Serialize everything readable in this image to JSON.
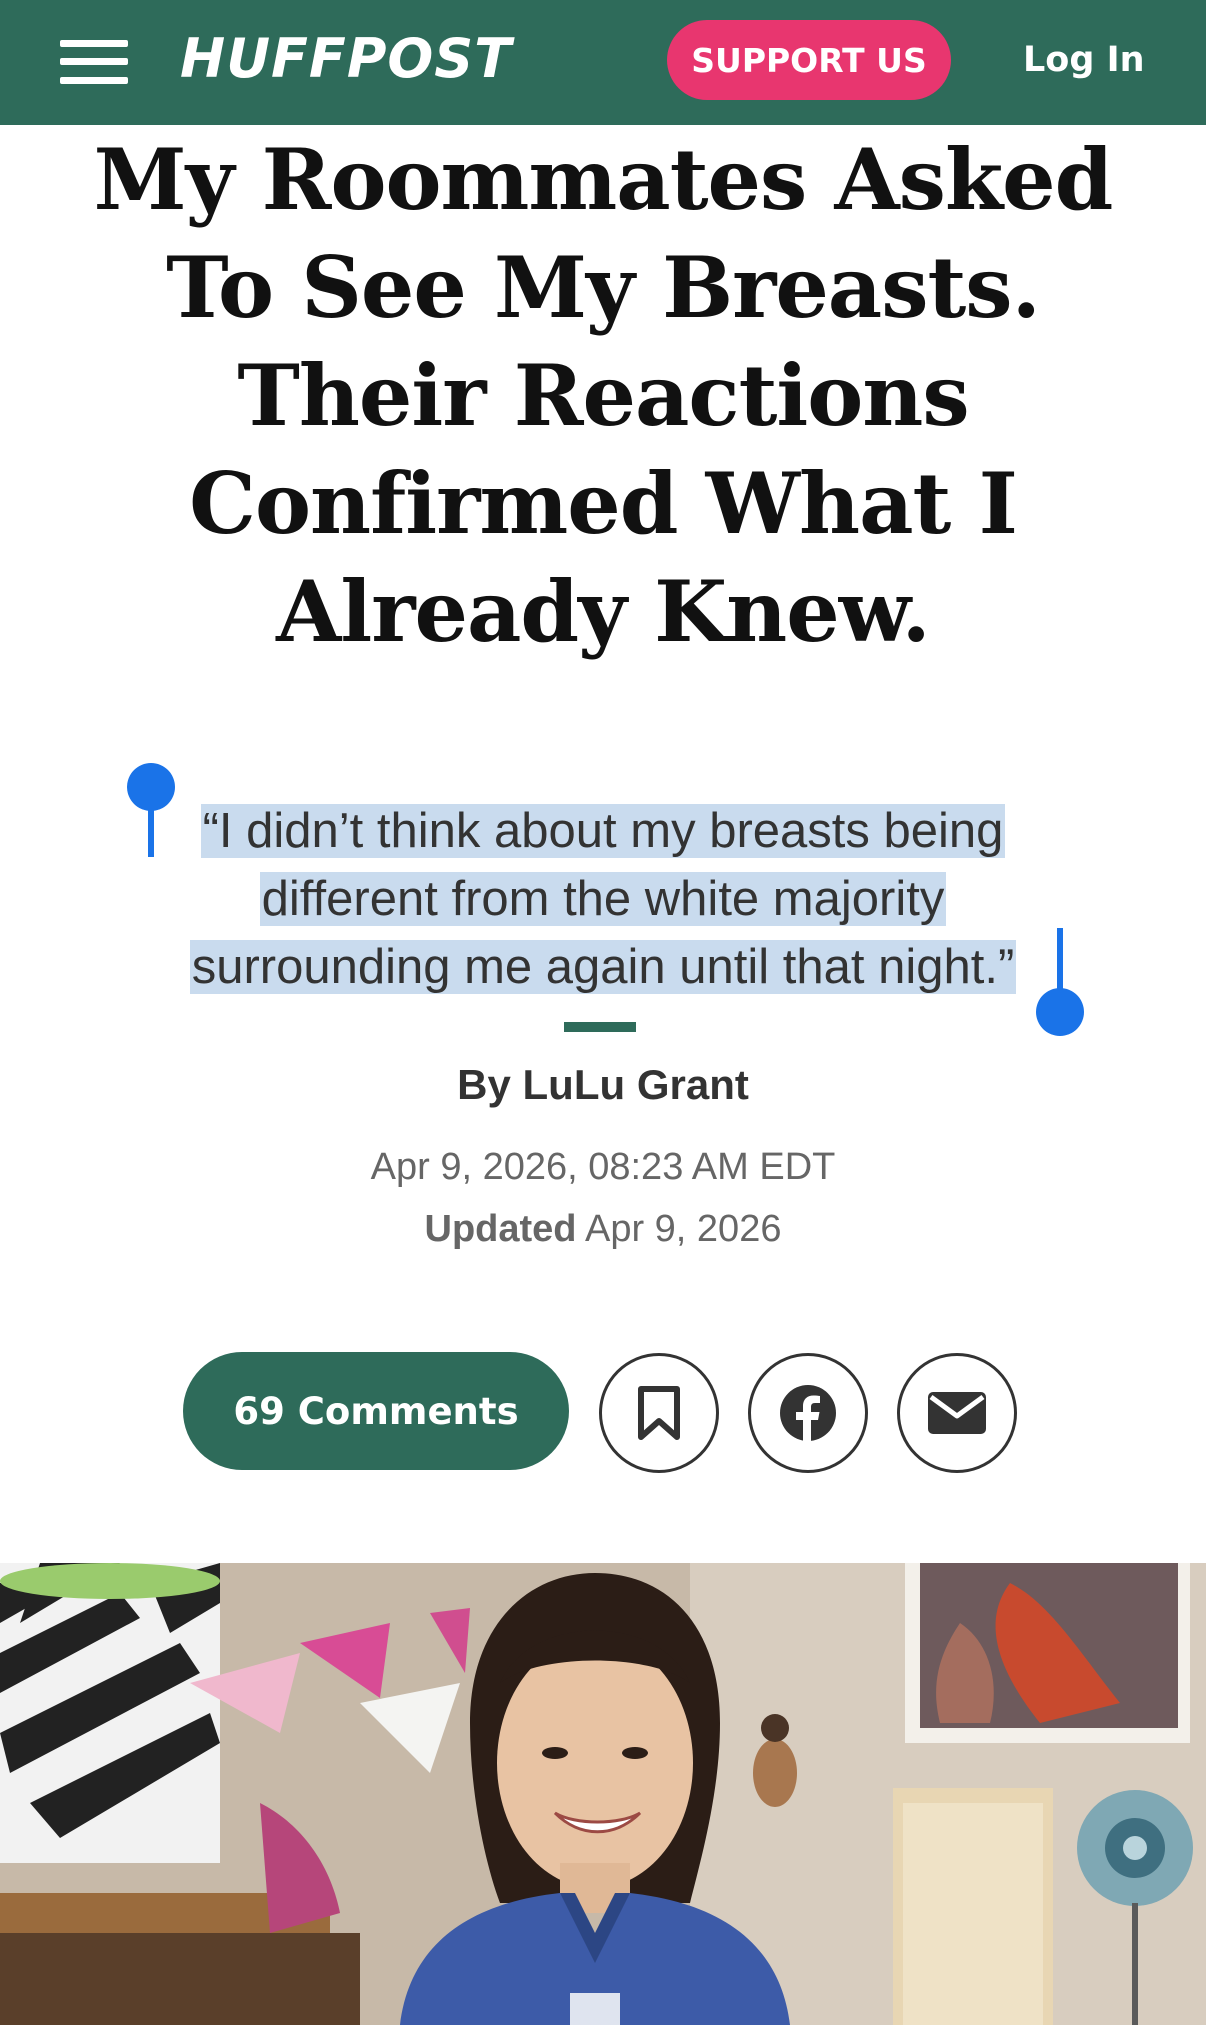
{
  "header": {
    "logo": "HUFFPOST",
    "support_label": "SUPPORT US",
    "login_label": "Log In"
  },
  "article": {
    "headline": "My Roommates Asked To See My Breasts. Their Reactions Confirmed What I Already Knew.",
    "dek": "“I didn’t think about my breasts being different from the white majority surrounding me again until that night.”",
    "byline_prefix": "By",
    "author": "LuLu Grant",
    "date": "Apr 9, 2026, 08:23 AM EDT",
    "updated_label": "Updated",
    "updated_date": "Apr 9, 2026"
  },
  "actions": {
    "comments_label": "69 Comments",
    "icons": [
      "bookmark-icon",
      "facebook-icon",
      "email-icon"
    ]
  },
  "colors": {
    "brand_green": "#2e6b5a",
    "support_pink": "#e8366f",
    "selection_blue": "#c9dbee",
    "handle_blue": "#1a73e8"
  }
}
